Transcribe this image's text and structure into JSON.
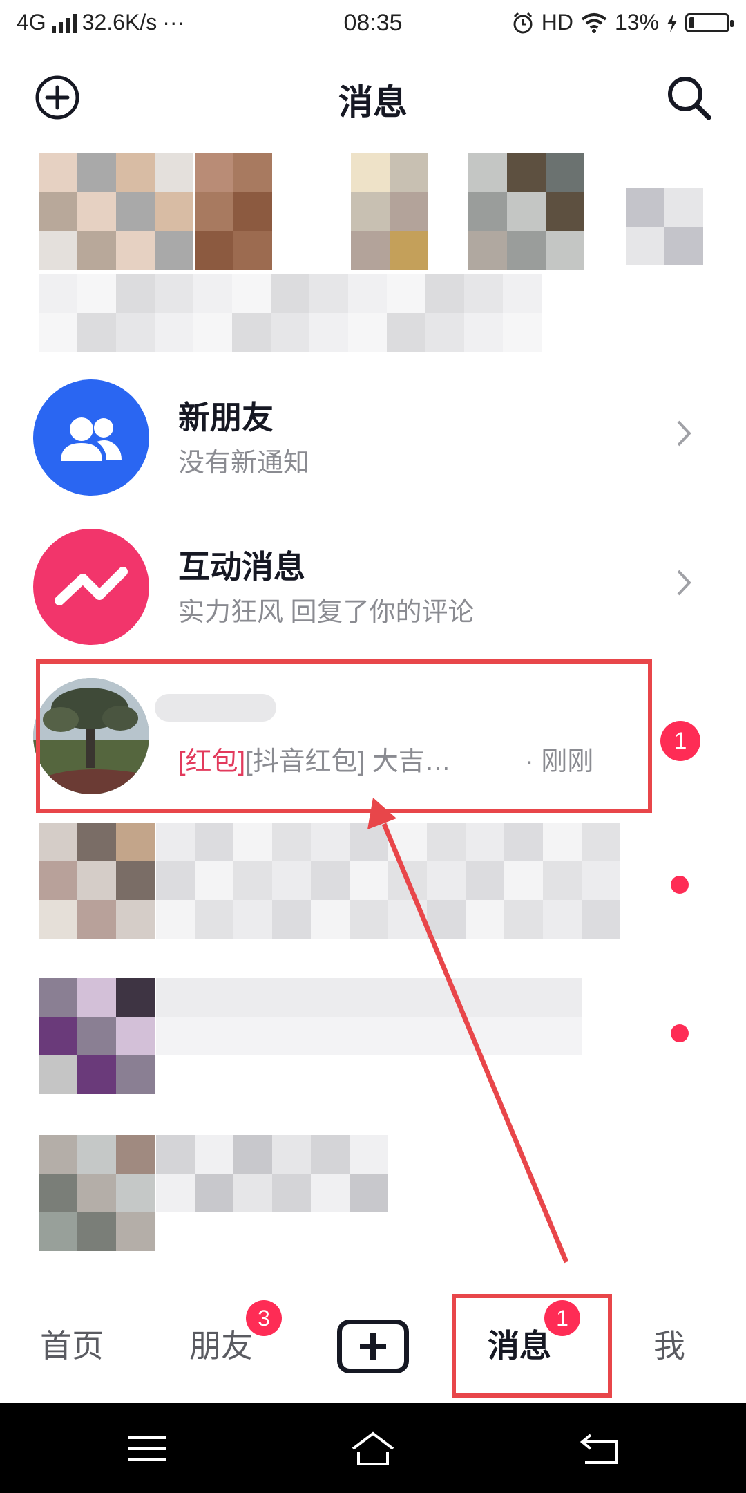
{
  "status_bar": {
    "network": "4G",
    "speed": "32.6K/s",
    "more": "···",
    "time": "08:35",
    "hd": "HD",
    "battery_pct": "13%",
    "battery_level": 0.13
  },
  "header": {
    "title": "消息"
  },
  "rows": [
    {
      "name": "新朋友",
      "subtitle": "没有新通知"
    },
    {
      "name": "互动消息",
      "subtitle": "实力狂风 回复了你的评论"
    },
    {
      "tag": "[红包]",
      "subtitle": "[抖音红包] 大吉…",
      "time": "· 刚刚",
      "badge": "1"
    }
  ],
  "bottom_nav": {
    "home": "首页",
    "friends": "朋友",
    "friends_badge": "3",
    "messages": "消息",
    "messages_badge": "1",
    "me": "我"
  },
  "colors": {
    "accent": "#fe2c55",
    "annotation": "#e8464a",
    "new_friend_avatar": "#2a66f2",
    "interact_avatar": "#f2356b"
  }
}
